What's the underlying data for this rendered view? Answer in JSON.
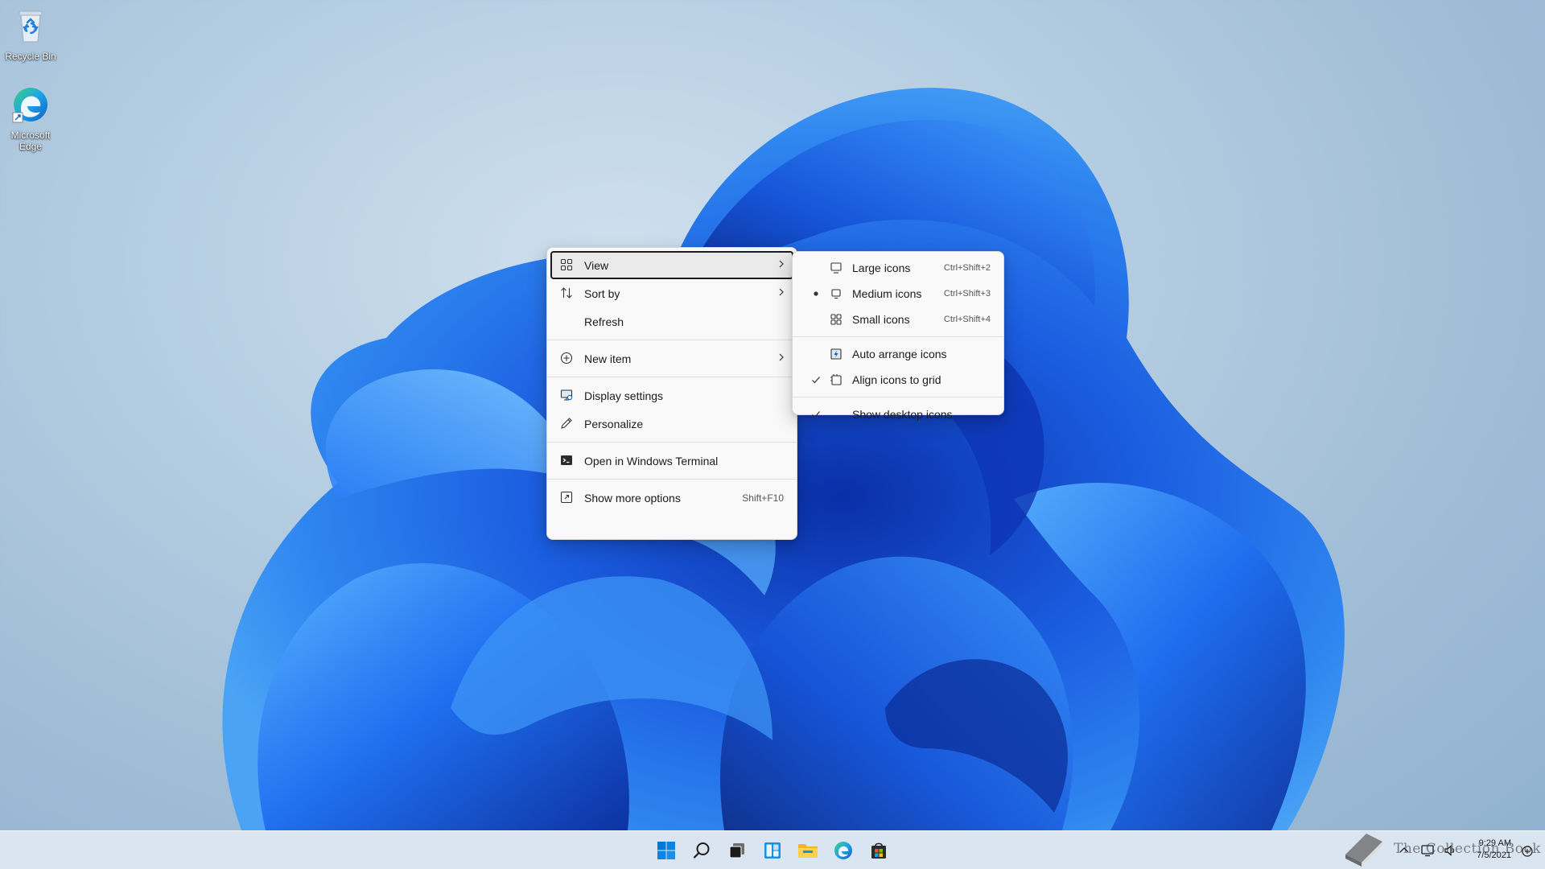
{
  "desktop": {
    "icons": [
      {
        "label": "Recycle Bin",
        "icon": "recycle-bin-icon"
      },
      {
        "label": "Microsoft Edge",
        "icon": "edge-icon"
      }
    ]
  },
  "context_menu": {
    "items": [
      {
        "label": "View",
        "icon": "view-grid-icon",
        "submenu": true
      },
      {
        "label": "Sort by",
        "icon": "sort-arrows-icon",
        "submenu": true
      },
      {
        "label": "Refresh"
      },
      {
        "label": "New item",
        "icon": "plus-circle-icon",
        "submenu": true
      },
      {
        "label": "Display settings",
        "icon": "display-icon"
      },
      {
        "label": "Personalize",
        "icon": "pen-icon"
      },
      {
        "label": "Open in Windows Terminal",
        "icon": "terminal-icon"
      },
      {
        "label": "Show more options",
        "icon": "more-options-icon",
        "shortcut": "Shift+F10"
      }
    ]
  },
  "view_submenu": {
    "items": [
      {
        "label": "Large icons",
        "shortcut": "Ctrl+Shift+2",
        "icon": "monitor-icon"
      },
      {
        "label": "Medium icons",
        "shortcut": "Ctrl+Shift+3",
        "icon": "monitor-icon",
        "selected": true
      },
      {
        "label": "Small icons",
        "shortcut": "Ctrl+Shift+4",
        "icon": "small-grid-icon"
      },
      {
        "label": "Auto arrange icons",
        "icon": "auto-arrange-icon"
      },
      {
        "label": "Align icons to grid",
        "icon": "align-grid-icon",
        "checked": true
      },
      {
        "label": "Show desktop icons",
        "checked": true
      }
    ]
  },
  "taskbar": {
    "apps": [
      "start-icon",
      "search-icon",
      "task-view-icon",
      "widgets-icon",
      "file-explorer-icon",
      "edge-icon",
      "store-icon"
    ],
    "clock": {
      "time": "9:29 AM",
      "date": "7/5/2021"
    }
  },
  "watermark": {
    "text": "The Collection Book"
  },
  "colors": {
    "accent": "#0067c0",
    "menu_bg": "#f9f9f9",
    "taskbar_bg": "#dee8f3"
  }
}
